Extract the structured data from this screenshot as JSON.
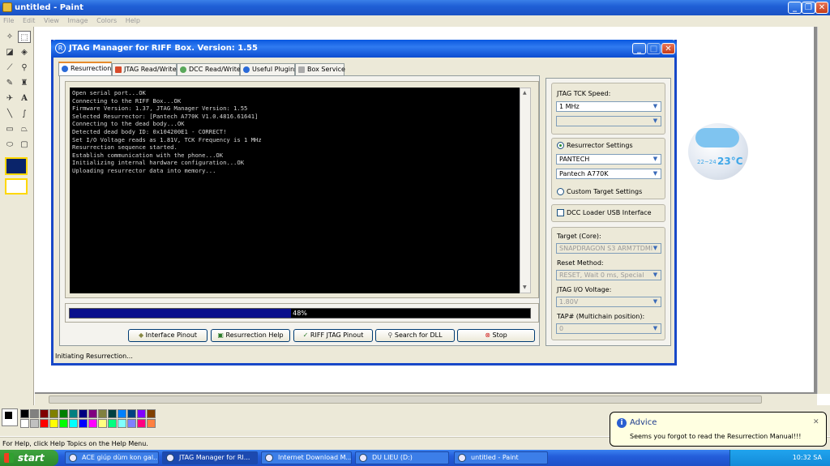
{
  "paint": {
    "title": "untitled - Paint",
    "menu": [
      "File",
      "Edit",
      "View",
      "Image",
      "Colors",
      "Help"
    ],
    "status": "For Help, click Help Topics on the Help Menu."
  },
  "jtag": {
    "title": "JTAG Manager for RIFF Box. Version: 1.55",
    "tabs": [
      "Resurrection",
      "JTAG Read/Write",
      "DCC Read/Write",
      "Useful Plugins",
      "Box Service"
    ],
    "console_lines": [
      "Open serial port...OK",
      "Connecting to the RIFF Box...OK",
      "Firmware Version: 1.37, JTAG Manager Version: 1.55",
      "Selected Resurrector: [Pantech A770K V1.0.4816.61641]",
      "",
      "Connecting to the dead body...OK",
      "Detected dead body ID: 0x104200E1 - CORRECT!",
      "Set I/O Voltage reads as 1.81V, TCK Frequency is 1 MHz",
      "",
      "Resurrection sequence started.",
      "Establish communication with the phone...OK",
      "Initializing internal hardware configuration...OK",
      "Uploading resurrector data into memory..."
    ],
    "progress_percent": 48,
    "progress_label": "48%",
    "buttons": [
      "Interface Pinout",
      "Resurrection Help",
      "RIFF JTAG Pinout",
      "Search for DLL",
      "Stop"
    ],
    "status": "Initiating Resurrection...",
    "right": {
      "tck_label": "JTAG TCK Speed:",
      "tck_value": "1 MHz",
      "resurrector_label": "Resurrector Settings",
      "manufacturer": "PANTECH",
      "model": "Pantech A770K",
      "custom_label": "Custom Target Settings",
      "dcc_label": "DCC Loader USB Interface",
      "target_label": "Target (Core):",
      "target_value": "SNAPDRAGON S3 ARM7TDMI",
      "reset_label": "Reset Method:",
      "reset_value": "RESET, Wait 0 ms, Special",
      "voltage_label": "JTAG I/O Voltage:",
      "voltage_value": "1.80V",
      "tap_label": "TAP# (Multichain position):",
      "tap_value": "0"
    }
  },
  "weather": {
    "range": "22~24",
    "temp": "23°C"
  },
  "advice": {
    "title": "Advice",
    "message": "Seems you forgot to read the Resurrection Manual!!!"
  },
  "taskbar": {
    "start": "start",
    "items": [
      "ACE giúp dùm kon gal...",
      "JTAG Manager for RI...",
      "Internet Download M...",
      "DU LIEU (D:)",
      "untitled - Paint"
    ],
    "clock": "10:32 SA"
  },
  "colors": {
    "palette_row1": [
      "#000000",
      "#808080",
      "#800000",
      "#808000",
      "#008000",
      "#008080",
      "#000080",
      "#800080",
      "#808040",
      "#004040",
      "#0080ff",
      "#004080",
      "#8000ff",
      "#804000"
    ],
    "palette_row2": [
      "#ffffff",
      "#c0c0c0",
      "#ff0000",
      "#ffff00",
      "#00ff00",
      "#00ffff",
      "#0000ff",
      "#ff00ff",
      "#ffff80",
      "#00ff80",
      "#80ffff",
      "#8080ff",
      "#ff0080",
      "#ff8040"
    ]
  }
}
